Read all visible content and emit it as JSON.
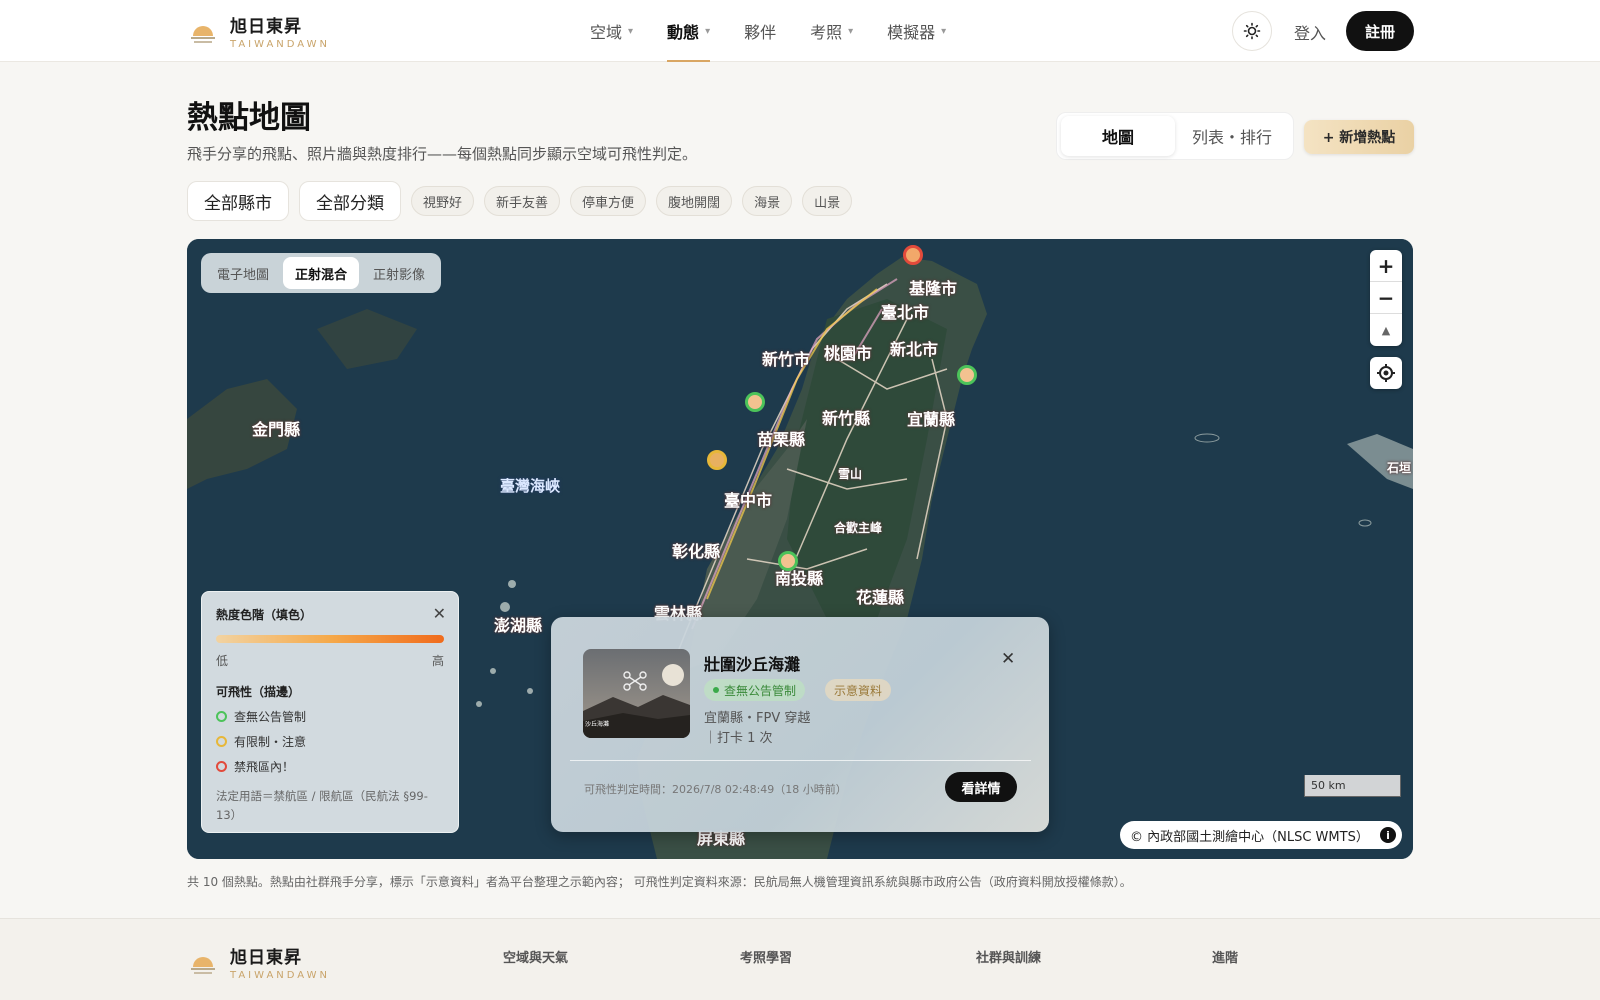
{
  "brand": {
    "name": "旭日東昇",
    "sub": "TAIWANDAWN"
  },
  "nav": [
    {
      "label": "空域",
      "chevron": "▾"
    },
    {
      "label": "動態",
      "chevron": "▾"
    },
    {
      "label": "夥伴",
      "chevron": ""
    },
    {
      "label": "考照",
      "chevron": "▾"
    },
    {
      "label": "模擬器",
      "chevron": "▾"
    }
  ],
  "header": {
    "login": "登入",
    "register": "註冊",
    "theme_icon": "sun-icon"
  },
  "page": {
    "title": "熱點地圖",
    "subtitle": "飛手分享的飛點、照片牆與熱度排行——每個熱點同步顯示空域可飛性判定。",
    "views": [
      "地圖",
      "列表・排行"
    ],
    "add_button": "+ 新增熱點"
  },
  "filters": {
    "county": "全部縣市",
    "category": "全部分類",
    "chips": [
      "視野好",
      "新手友善",
      "停車方便",
      "腹地開闊",
      "海景",
      "山景"
    ]
  },
  "map": {
    "layers": [
      "電子地圖",
      "正射混合",
      "正射影像"
    ],
    "active_layer": "正射混合",
    "zoom_in": "+",
    "zoom_out": "−",
    "compass": "▲",
    "labels": {
      "keelung": "基隆市",
      "taipei": "臺北市",
      "newtaipei": "新北市",
      "hsinchu_city": "新竹市",
      "taoyuan": "桃園市",
      "hsinchu_county": "新竹縣",
      "yilan": "宜蘭縣",
      "miaoli": "苗栗縣",
      "taichung": "臺中市",
      "changhua": "彰化縣",
      "nantou": "南投縣",
      "hualien": "花蓮縣",
      "yunlin": "雲林縣",
      "pingtung": "屏東縣",
      "kinmen": "金門縣",
      "penghu": "澎湖縣",
      "strait": "臺灣海峽",
      "yushan": "雪山",
      "hehuan": "合歡主峰",
      "ishigaki": "石垣"
    },
    "colors": {
      "green": "#4cc35a",
      "yellow": "#e7b739",
      "red": "#e24a3b"
    },
    "legend": {
      "title": "熱度色階（填色）",
      "low": "低",
      "high": "高",
      "sub": "可飛性（描邊）",
      "items": [
        "查無公告管制",
        "有限制・注意",
        "禁飛區內！"
      ],
      "note": "法定用語＝禁航區 / 限航區（民航法 §99-13）"
    },
    "popup": {
      "title": "壯圍沙丘海灘",
      "thumb_caption": "沙丘海灘",
      "badge_status": "查無公告管制",
      "badge_sample": "示意資料",
      "meta1": "宜蘭縣・FPV 穿越",
      "meta2": "｜打卡 1 次",
      "time": "可飛性判定時間：2026/7/8 02:48:49（18 小時前）",
      "detail": "看詳情"
    },
    "scale": "50 km",
    "attribution": "© 內政部國土測繪中心（NLSC WMTS）",
    "info_icon": "i"
  },
  "footnote": "共 10 個熱點。熱點由社群飛手分享，標示「示意資料」者為平台整理之示範內容； 可飛性判定資料來源：民航局無人機管理資訊系統與縣市政府公告（政府資料開放授權條款）。",
  "footer": {
    "cols": [
      "空域與天氣",
      "考照學習",
      "社群與訓練",
      "進階"
    ]
  }
}
